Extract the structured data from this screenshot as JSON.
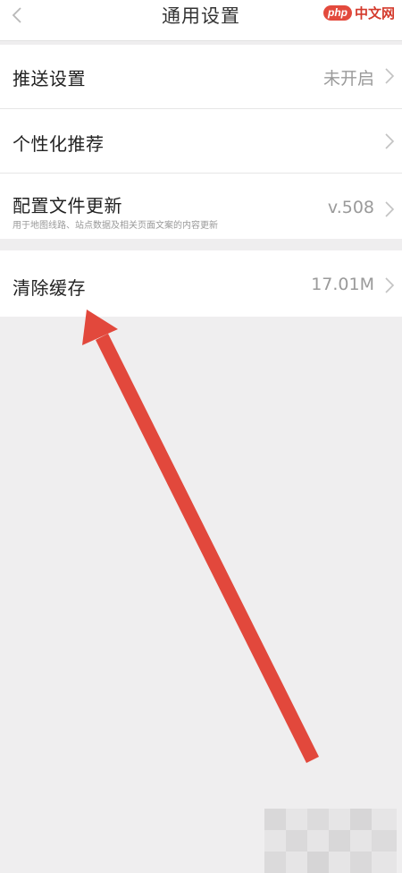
{
  "header": {
    "title": "通用设置",
    "back_icon": "chevron-left-icon"
  },
  "watermark": {
    "logo": "php",
    "text": "中文网"
  },
  "group1": {
    "rows": [
      {
        "title": "推送设置",
        "value": "未开启"
      },
      {
        "title": "个性化推荐",
        "value": ""
      },
      {
        "title": "配置文件更新",
        "subtitle": "用于地图线路、站点数据及相关页面文案的内容更新",
        "value": "v.508"
      }
    ]
  },
  "group2": {
    "rows": [
      {
        "title": "清除缓存",
        "value": "17.01M"
      }
    ]
  },
  "colors": {
    "background": "#efeeef",
    "card": "#ffffff",
    "arrow": "#e2483c",
    "value_text": "#9a9a9a"
  }
}
